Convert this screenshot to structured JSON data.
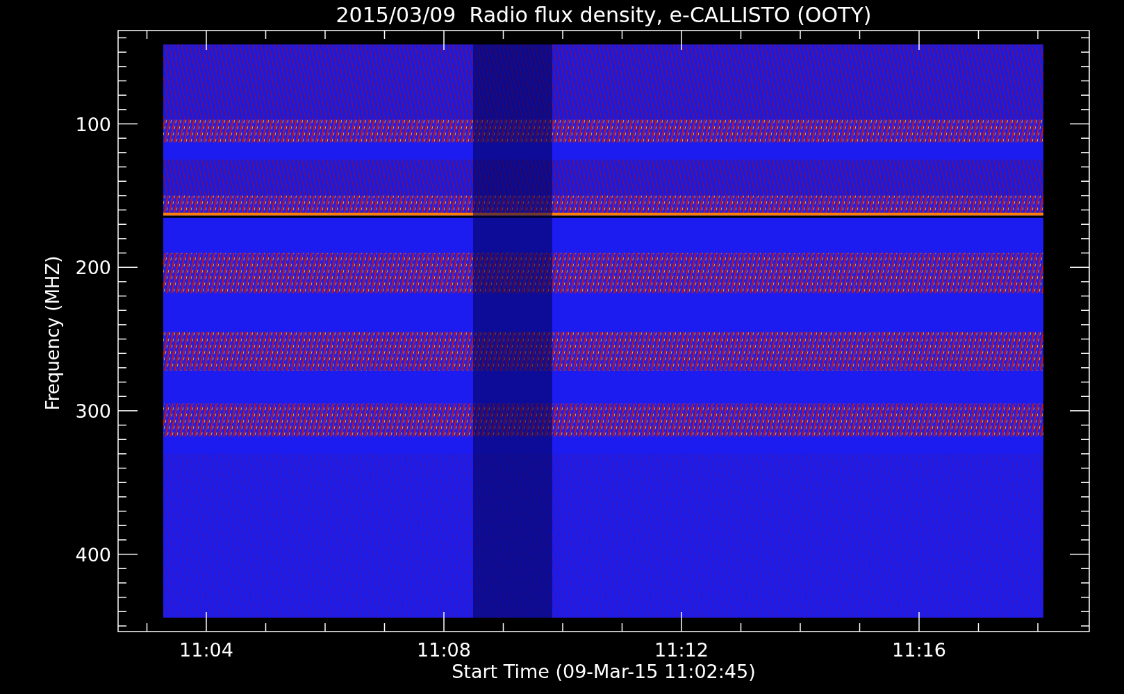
{
  "title": "2015/03/09  Radio flux density, e-CALLISTO (OOTY)",
  "y_axis": {
    "label": "Frequency (MHZ)",
    "ticks": [
      "100",
      "200",
      "300",
      "400"
    ]
  },
  "x_axis": {
    "label": "Start Time (09-Mar-15 11:02:45)",
    "ticks": [
      "11:04",
      "11:08",
      "11:12",
      "11:16"
    ]
  }
}
